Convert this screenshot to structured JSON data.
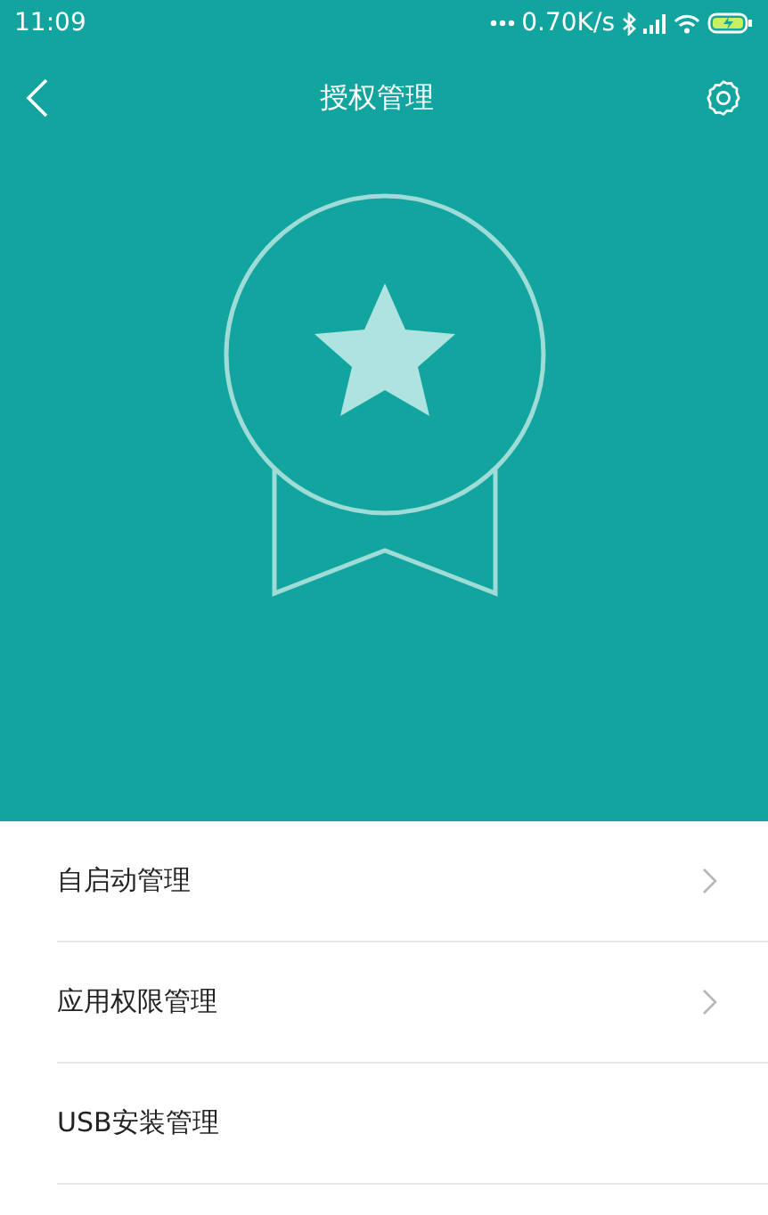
{
  "status_bar": {
    "time": "11:09",
    "speed": "0.70K/s"
  },
  "header": {
    "title": "授权管理"
  },
  "items": [
    {
      "label": "自启动管理",
      "chevron": true
    },
    {
      "label": "应用权限管理",
      "chevron": true
    },
    {
      "label": "USB安装管理",
      "chevron": false
    }
  ]
}
